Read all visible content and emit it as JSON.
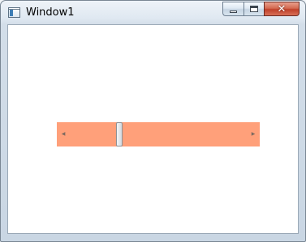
{
  "window": {
    "title": "Window1"
  },
  "titlebar": {
    "icon": "app-window-icon",
    "buttons": {
      "minimize_icon": "minimize-icon",
      "maximize_icon": "maximize-icon",
      "close_glyph": "✕"
    }
  },
  "scrollbar": {
    "orientation": "horizontal",
    "track_color": "#FFA07A",
    "value_fraction": 0.27,
    "left_arrow_glyph": "◀",
    "right_arrow_glyph": "▶"
  }
}
